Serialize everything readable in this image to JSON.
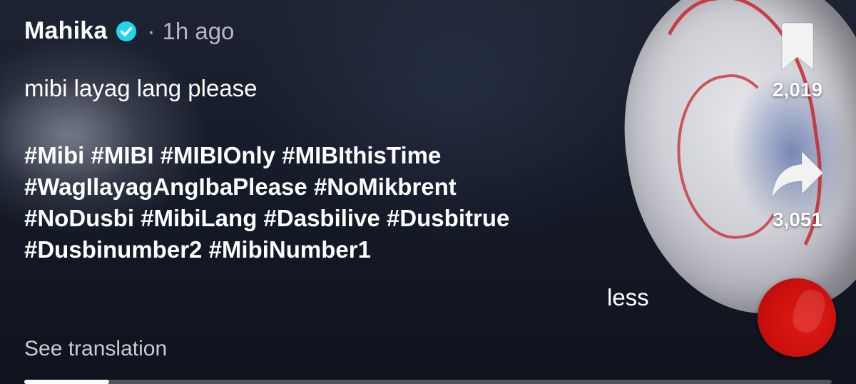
{
  "post": {
    "username": "Mahika",
    "verified": true,
    "separator": "·",
    "time": "1h ago",
    "caption": "mibi layag lang please",
    "hashtag_lines": [
      [
        "#Mibi",
        "#MIBI",
        "#MIBIOnly",
        "#MIBIthisTime"
      ],
      [
        "#WagIlayagAngIbaPlease",
        "#NoMikbrent"
      ],
      [
        "#NoDusbi",
        "#MibiLang",
        "#Dasbilive",
        "#Dusbitrue"
      ],
      [
        "#Dusbinumber2",
        "#MibiNumber1"
      ]
    ],
    "less_label": "less",
    "see_translation_label": "See translation"
  },
  "actions": {
    "bookmark": {
      "icon": "bookmark-icon",
      "count": "2,019"
    },
    "share": {
      "icon": "share-icon",
      "count": "3,051"
    },
    "sound": {
      "icon": "sound-disc-icon"
    }
  },
  "progress": {
    "fraction": 0.105
  },
  "colors": {
    "verified_badge": "#20d5ec",
    "sound_disc": "#d3120e",
    "muted_text": "#b4b8c2"
  }
}
